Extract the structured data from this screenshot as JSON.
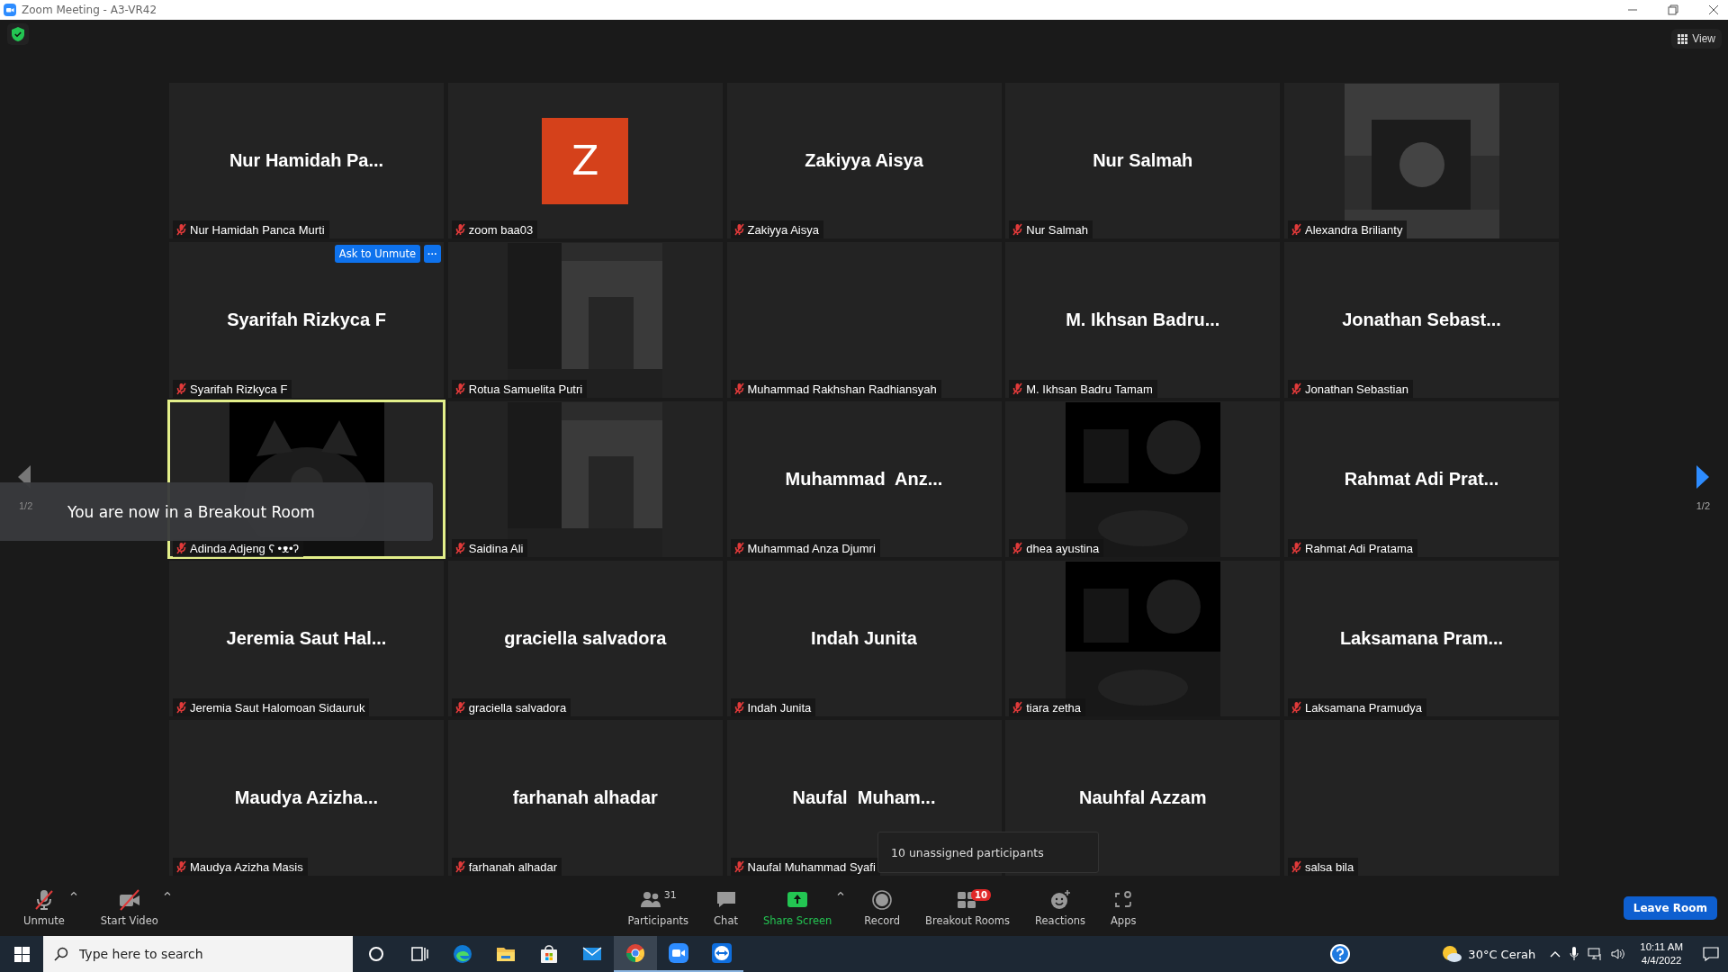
{
  "window": {
    "title": "Zoom Meeting - A3-VR42"
  },
  "top_bar": {
    "view_button": "View"
  },
  "pager": {
    "left": "1/2",
    "right": "1/2"
  },
  "tiles": [
    {
      "kind": "name",
      "display": "Nur Hamidah Pa...",
      "label": "Nur Hamidah Panca Murti",
      "muted": true,
      "speaking": false
    },
    {
      "kind": "avatar",
      "initial": "Z",
      "label": "zoom baa03",
      "muted": true,
      "speaking": false
    },
    {
      "kind": "name",
      "display": "Zakiyya Aisya",
      "label": "Zakiyya Aisya",
      "muted": true,
      "speaking": false
    },
    {
      "kind": "name",
      "display": "Nur Salmah",
      "label": "Nur Salmah",
      "muted": true,
      "speaking": false
    },
    {
      "kind": "video",
      "label": "Alexandra Brilianty",
      "muted": true,
      "speaking": false
    },
    {
      "kind": "name",
      "display": "Syarifah Rizkyca F",
      "label": "Syarifah Rizkyca F",
      "muted": true,
      "speaking": false,
      "actions": {
        "button": "Ask to Unmute",
        "more": "···"
      }
    },
    {
      "kind": "video",
      "label": "Rotua Samuelita Putri",
      "muted": true,
      "speaking": false
    },
    {
      "kind": "blank",
      "label": "Muhammad Rakhshan Radhiansyah",
      "muted": true,
      "speaking": false
    },
    {
      "kind": "name",
      "display": "M. Ikhsan Badru...",
      "label": "M. Ikhsan Badru Tamam",
      "muted": true,
      "speaking": false
    },
    {
      "kind": "name",
      "display": "Jonathan Sebast...",
      "label": "Jonathan Sebastian",
      "muted": true,
      "speaking": false
    },
    {
      "kind": "video",
      "label": "Adinda Adjeng ʕ •ᴥ•ʔ",
      "muted": true,
      "speaking": true
    },
    {
      "kind": "video",
      "label": "Saidina Ali",
      "muted": true,
      "speaking": false
    },
    {
      "kind": "name",
      "display": "Muhammad  Anz...",
      "label": "Muhammad Anza Djumri",
      "muted": true,
      "speaking": false
    },
    {
      "kind": "video",
      "label": "dhea ayustina",
      "muted": true,
      "speaking": false
    },
    {
      "kind": "name",
      "display": "Rahmat Adi Prat...",
      "label": "Rahmat Adi Pratama",
      "muted": true,
      "speaking": false
    },
    {
      "kind": "name",
      "display": "Jeremia Saut Hal...",
      "label": "Jeremia Saut Halomoan Sidauruk",
      "muted": true,
      "speaking": false
    },
    {
      "kind": "name",
      "display": "graciella salvadora",
      "label": "graciella salvadora",
      "muted": true,
      "speaking": false
    },
    {
      "kind": "name",
      "display": "Indah Junita",
      "label": "Indah Junita",
      "muted": true,
      "speaking": false
    },
    {
      "kind": "video",
      "label": "tiara zetha",
      "muted": true,
      "speaking": false
    },
    {
      "kind": "name",
      "display": "Laksamana Pram...",
      "label": "Laksamana Pramudya",
      "muted": true,
      "speaking": false
    },
    {
      "kind": "name",
      "display": "Maudya Azizha...",
      "label": "Maudya Azizha Masis",
      "muted": true,
      "speaking": false
    },
    {
      "kind": "name",
      "display": "farhanah alhadar",
      "label": "farhanah alhadar",
      "muted": true,
      "speaking": false
    },
    {
      "kind": "name",
      "display": "Naufal  Muham...",
      "label": "Naufal Muhammad Syafi",
      "muted": true,
      "speaking": false
    },
    {
      "kind": "name",
      "display": "Nauhfal Azzam",
      "speaking": false
    },
    {
      "kind": "blank",
      "label": "salsa bila",
      "muted": true,
      "speaking": false
    }
  ],
  "banner": "You are now in a Breakout Room",
  "tooltip": "10 unassigned participants",
  "toolbar": {
    "left": [
      {
        "kind": "mic",
        "label": "Unmute",
        "caret": true
      },
      {
        "kind": "camera",
        "label": "Start Video",
        "caret": true
      }
    ],
    "center": [
      {
        "kind": "participants",
        "label": "Participants",
        "count": "31"
      },
      {
        "kind": "chat",
        "label": "Chat"
      },
      {
        "kind": "share",
        "label": "Share Screen",
        "caret": true
      },
      {
        "kind": "record",
        "label": "Record"
      },
      {
        "kind": "breakout",
        "label": "Breakout Rooms",
        "badge": "10"
      },
      {
        "kind": "reactions",
        "label": "Reactions"
      },
      {
        "kind": "apps",
        "label": "Apps"
      }
    ],
    "leave_button": "Leave Room"
  },
  "taskbar": {
    "search": {
      "placeholder": "Type here to search"
    },
    "apps": [
      {
        "kind": "cortana",
        "selected": false,
        "running": false
      },
      {
        "kind": "taskview",
        "selected": false,
        "running": false
      },
      {
        "kind": "edge",
        "selected": false,
        "running": false
      },
      {
        "kind": "explorer",
        "selected": false,
        "running": false
      },
      {
        "kind": "store",
        "selected": false,
        "running": false
      },
      {
        "kind": "mail",
        "selected": false,
        "running": false
      },
      {
        "kind": "chrome",
        "selected": true,
        "running": true
      },
      {
        "kind": "zoom",
        "selected": false,
        "running": true
      },
      {
        "kind": "teamviewer",
        "selected": false,
        "running": true
      }
    ],
    "weather": "30°C Cerah",
    "time": "10:11 AM",
    "date": "4/4/2022"
  }
}
